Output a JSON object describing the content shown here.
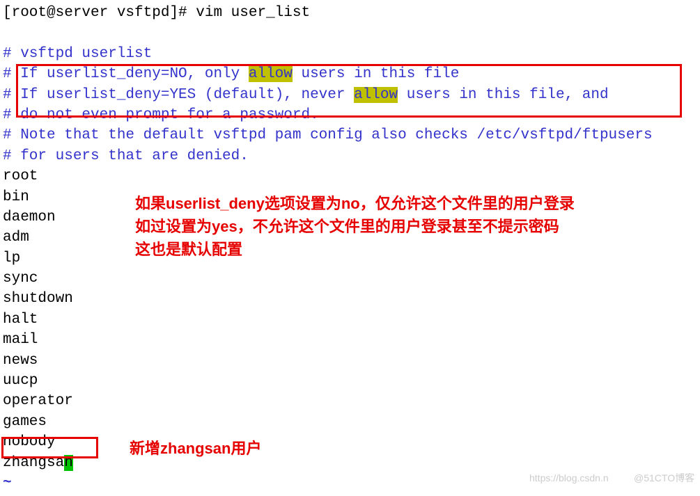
{
  "prompt": {
    "text": "[root@server vsftpd]# ",
    "command": "vim user_list"
  },
  "comments": {
    "c1": "# vsftpd userlist",
    "c2_a": "# If userlist_deny=NO, only ",
    "c2_b": "allow",
    "c2_c": " users in this file",
    "c3_a": "# If userlist_deny=YES (default), never ",
    "c3_b": "allow",
    "c3_c": " users in this file, and",
    "c4": "# do not even prompt for a password.",
    "c5": "# Note that the default vsftpd pam config also checks /etc/vsftpd/ftpusers",
    "c6": "# for users that are denied."
  },
  "users": {
    "u1": "root",
    "u2": "bin",
    "u3": "daemon",
    "u4": "adm",
    "u5": "lp",
    "u6": "sync",
    "u7": "shutdown",
    "u8": "halt",
    "u9": "mail",
    "u10": "news",
    "u11": "uucp",
    "u12": "operator",
    "u13": "games",
    "u14": "nobody",
    "u15_a": "zhangsa",
    "u15_b": "n"
  },
  "vim_tilde": "~",
  "annotations": {
    "main": "如果userlist_deny选项设置为no，仅允许这个文件里的用户登录\n如过设置为yes，不允许这个文件里的用户登录甚至不提示密码\n这也是默认配置",
    "bottom": "新增zhangsan用户"
  },
  "watermark": {
    "left": "https://blog.csdn.n",
    "right": "@51CTO博客"
  }
}
